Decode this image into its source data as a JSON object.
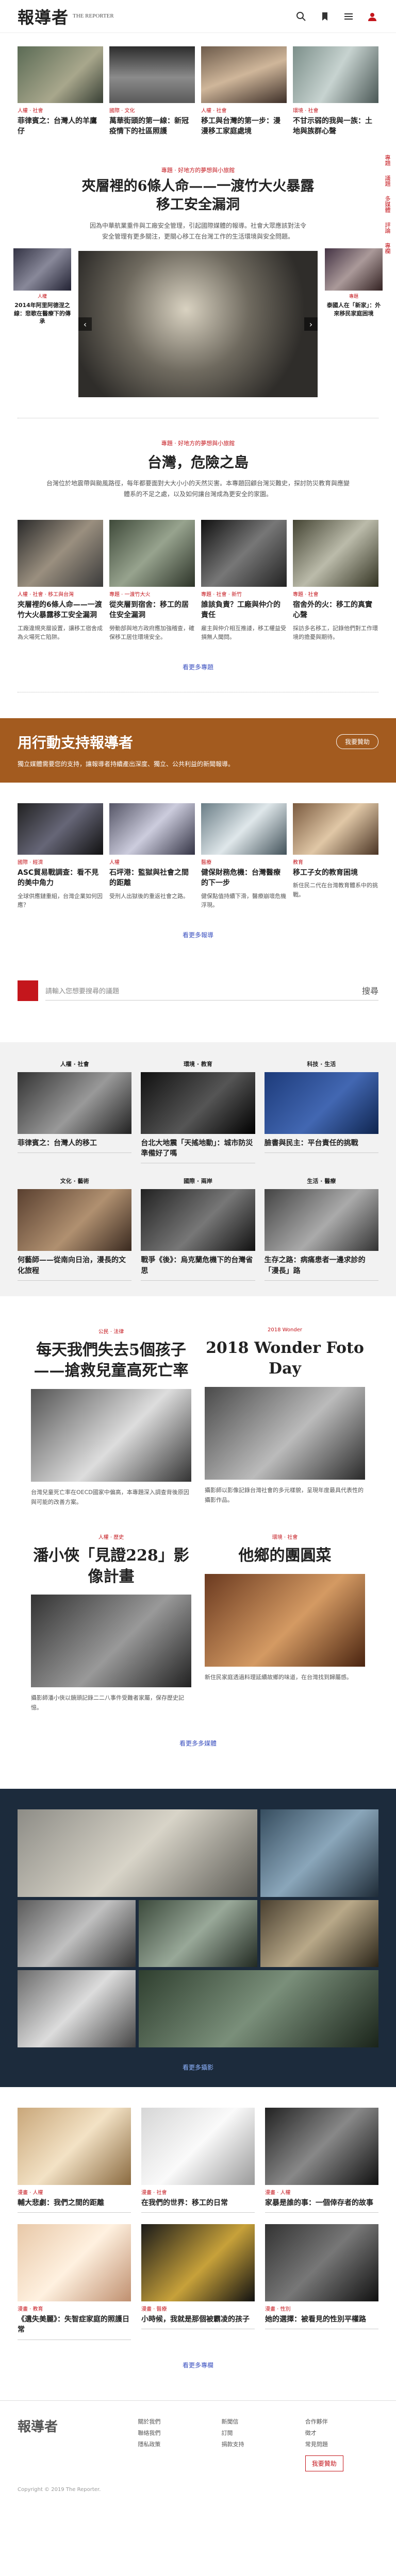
{
  "header": {
    "logo_cn": "報導者",
    "logo_en": "THE REPORTER",
    "icons": [
      "search-icon",
      "bookmark-icon",
      "menu-icon",
      "user-icon"
    ]
  },
  "top_cards": [
    {
      "tag": "人權 · 社會",
      "title": "菲律賓之：台灣人的羊鷹仔"
    },
    {
      "tag": "國際 · 文化",
      "title": "萬華街頭的第一線：新冠疫情下的社區照護"
    },
    {
      "tag": "人權 · 社會",
      "title": "移工與台灣的第一步：漫漫移工家庭處境"
    },
    {
      "tag": "環境 · 社會",
      "title": "不甘示弱的我與一族：土地與族群心聲"
    }
  ],
  "carousel": {
    "left": {
      "tag": "人權",
      "title": "2014年阿里阿德涅之線：悲歌在醫療下的傳承"
    },
    "main": {
      "tag": "專題 · 好地方的夢想與小旅館",
      "title": "夾層裡的6條人命——一渡竹大火暴露移工安全漏洞",
      "desc": "因為中華航業重件與工廠安全管理，引起國際媒體的報導。社會大眾應該對法令安全管理有更多關注，更關心移工在台灣工作的生活環境與安全問題。"
    },
    "right": {
      "tag": "專題",
      "title": "泰國人在「新家」：外來移民家庭困境"
    }
  },
  "section_taiwan": {
    "tag": "專題 · 好地方的夢想與小旅館",
    "title": "台灣，危險之島",
    "desc": "台灣位於地震帶與颱風路徑，每年都要面對大大小小的天然災害。本專題回顧台灣災難史，探討防災教育與應變體系的不足之處，以及如何讓台灣成為更安全的家園。"
  },
  "mid_cards": [
    {
      "tag": "人權 · 社會 · 移工與台灣",
      "title": "夾層裡的6條人命——一渡竹大火暴露移工安全漏洞",
      "desc": "工廠違規夾層設置，讓移工宿舍成為火場死亡陷阱。"
    },
    {
      "tag": "專題 · 一渡竹大火",
      "title": "從夾層到宿舍：移工的居住安全漏洞",
      "desc": "勞動部與地方政府應加強稽查，確保移工居住環境安全。"
    },
    {
      "tag": "專題 · 社會 · 新竹",
      "title": "誰該負責？工廠與仲介的責任",
      "desc": "雇主與仲介相互推諉，移工權益受損無人聞問。"
    },
    {
      "tag": "專題 · 社會",
      "title": "宿舍外的火：移工的真實心聲",
      "desc": "採訪多名移工，記錄他們對工作環境的擔憂與期待。"
    }
  ],
  "more_link_1": "看更多專題",
  "support": {
    "title": "用行動支持報導者",
    "button": "我要贊助",
    "text": "獨立媒體需要您的支持，讓報導者持續產出深度、獨立、公共利益的新聞報導。"
  },
  "grid_cards": [
    {
      "tag": "國際 · 經濟",
      "title": "ASC貿易戰調查：看不見的美中角力",
      "desc": "全球供應鏈重組，台灣企業如何因應？"
    },
    {
      "tag": "人權",
      "title": "石坪港：監獄與社會之間的距離",
      "desc": "受刑人出獄後的重返社會之路。"
    },
    {
      "tag": "醫療",
      "title": "健保財務危機：台灣醫療的下一步",
      "desc": "健保點值持續下滑，醫療崩壞危機浮現。"
    },
    {
      "tag": "教育",
      "title": "移工子女的教育困境",
      "desc": "新住民二代在台灣教育體系中的挑戰。"
    }
  ],
  "more_link_2": "看更多報導",
  "search": {
    "placeholder": "請輸入您想要搜尋的議題",
    "button": "搜尋"
  },
  "categories": [
    {
      "label": "人權 · 社會",
      "title": "菲律賓之：台灣人的移工"
    },
    {
      "label": "環境 · 教育",
      "title": "台北大地震「天搖地動」：城市防災準備好了嗎"
    },
    {
      "label": "科技 · 生活",
      "title": "臉書與民主：平台責任的挑戰"
    },
    {
      "label": "文化 · 藝術",
      "title": "何藝師——從南向日治，漫長的文化旅程"
    },
    {
      "label": "國際 · 兩岸",
      "title": "戰爭《後》：烏克蘭危機下的台灣省思"
    },
    {
      "label": "生活 · 醫療",
      "title": "生存之路：病痛患者一邊求診的「漫長」路"
    }
  ],
  "features_1": [
    {
      "tag": "公民 · 法律",
      "title": "每天我們失去5個孩子——搶救兒童高死亡率",
      "desc": "台灣兒童死亡率在OECD國家中偏高，本專題深入調查背後原因與可能的改善方案。"
    },
    {
      "tag": "2018 Wonder",
      "title": "2018 Wonder Foto Day",
      "desc": "攝影師以影像記錄台灣社會的多元樣貌，呈現年度最具代表性的攝影作品。"
    }
  ],
  "features_2": [
    {
      "tag": "人權 · 歷史",
      "title": "潘小俠「見證228」影像計畫",
      "desc": "攝影師潘小俠以鏡頭記錄二二八事件受難者家屬，保存歷史記憶。"
    },
    {
      "tag": "環境 · 社會",
      "title": "他鄉的團圓菜",
      "desc": "新住民家庭透過料理延續故鄉的味道，在台灣找到歸屬感。"
    }
  ],
  "more_link_3": "看更多多媒體",
  "dark_link": "看更多攝影",
  "comics": [
    {
      "tag": "漫畫 · 人權",
      "title": "輔大悲劇：我們之間的距離"
    },
    {
      "tag": "漫畫 · 社會",
      "title": "在我們的世界：移工的日常"
    },
    {
      "tag": "漫畫 · 人權",
      "title": "家暴是誰的事：一個倖存者的故事"
    },
    {
      "tag": "漫畫 · 教育",
      "title": "《遺失美麗》：失智症家庭的照護日常"
    },
    {
      "tag": "漫畫 · 醫療",
      "title": "小時候，我就是那個被霸凌的孩子"
    },
    {
      "tag": "漫畫 · 性別",
      "title": "她的選擇：被看見的性別平權路"
    }
  ],
  "more_link_4": "看更多專欄",
  "footer": {
    "logo": "報導者",
    "col1": [
      "關於我們",
      "聯絡我們",
      "隱私政策"
    ],
    "col2": [
      "新聞信",
      "訂閱",
      "捐款支持"
    ],
    "col3": [
      "合作夥伴",
      "徵才",
      "常見問題"
    ],
    "button": "我要贊助",
    "copyright": "Copyright © 2019 The Reporter."
  },
  "side_nav": [
    "專題",
    "議題",
    "多媒體",
    "評論",
    "專欄"
  ]
}
